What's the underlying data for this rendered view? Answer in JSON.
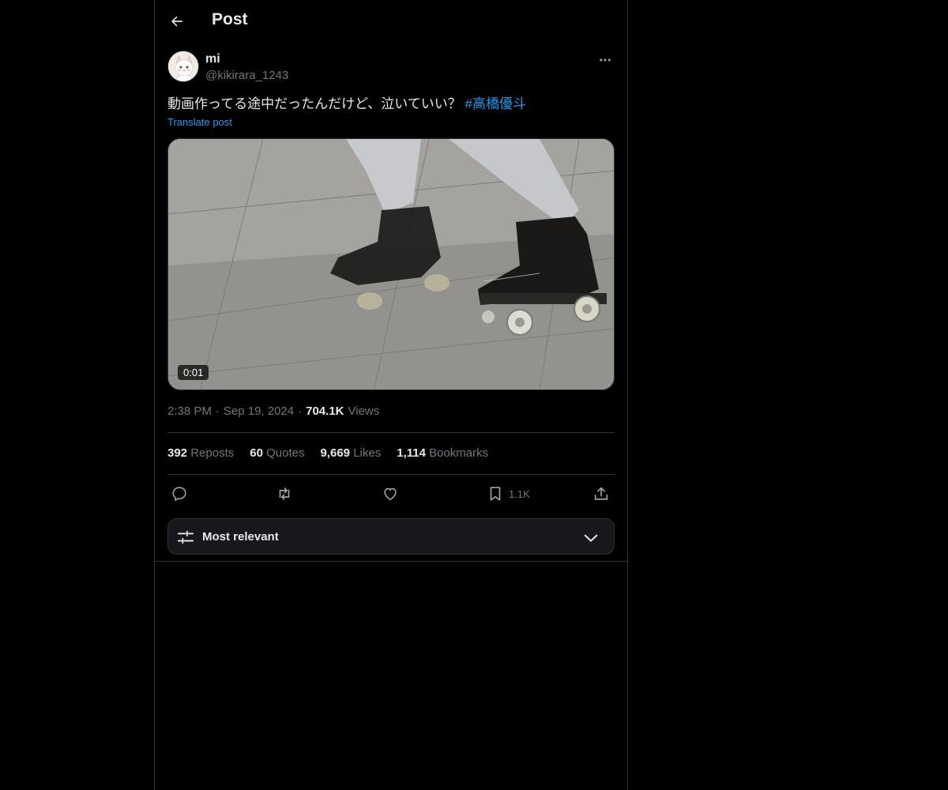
{
  "header": {
    "title": "Post",
    "back_icon": "arrow-left-icon"
  },
  "post": {
    "author": {
      "display_name": "mi",
      "handle": "@kikirara_1243",
      "avatar_icon": "cat-avatar"
    },
    "text": "動画作ってる途中だったんだけど、泣いていい？ ",
    "hashtag": "#高橋優斗",
    "translate_label": "Translate post",
    "media": {
      "type": "video",
      "duration": "0:01"
    },
    "time": "2:38 PM",
    "separator": "·",
    "date": "Sep 19, 2024",
    "views_count": "704.1K",
    "views_label": "Views"
  },
  "stats": {
    "reposts_count": "392",
    "reposts_label": "Reposts",
    "quotes_count": "60",
    "quotes_label": "Quotes",
    "likes_count": "9,669",
    "likes_label": "Likes",
    "bookmarks_count": "1,114",
    "bookmarks_label": "Bookmarks"
  },
  "actions": {
    "reply_icon": "reply-icon",
    "repost_icon": "repost-icon",
    "like_icon": "heart-icon",
    "bookmark_icon": "bookmark-icon",
    "bookmark_count": "1.1K",
    "share_icon": "share-icon"
  },
  "sort": {
    "label": "Most relevant",
    "icon": "sliders-icon",
    "chevron": "chevron-down-icon"
  },
  "colors": {
    "background": "#000000",
    "text": "#e7e9ea",
    "muted": "#71767b",
    "accent": "#1d9bf0",
    "border": "#2f3336"
  }
}
